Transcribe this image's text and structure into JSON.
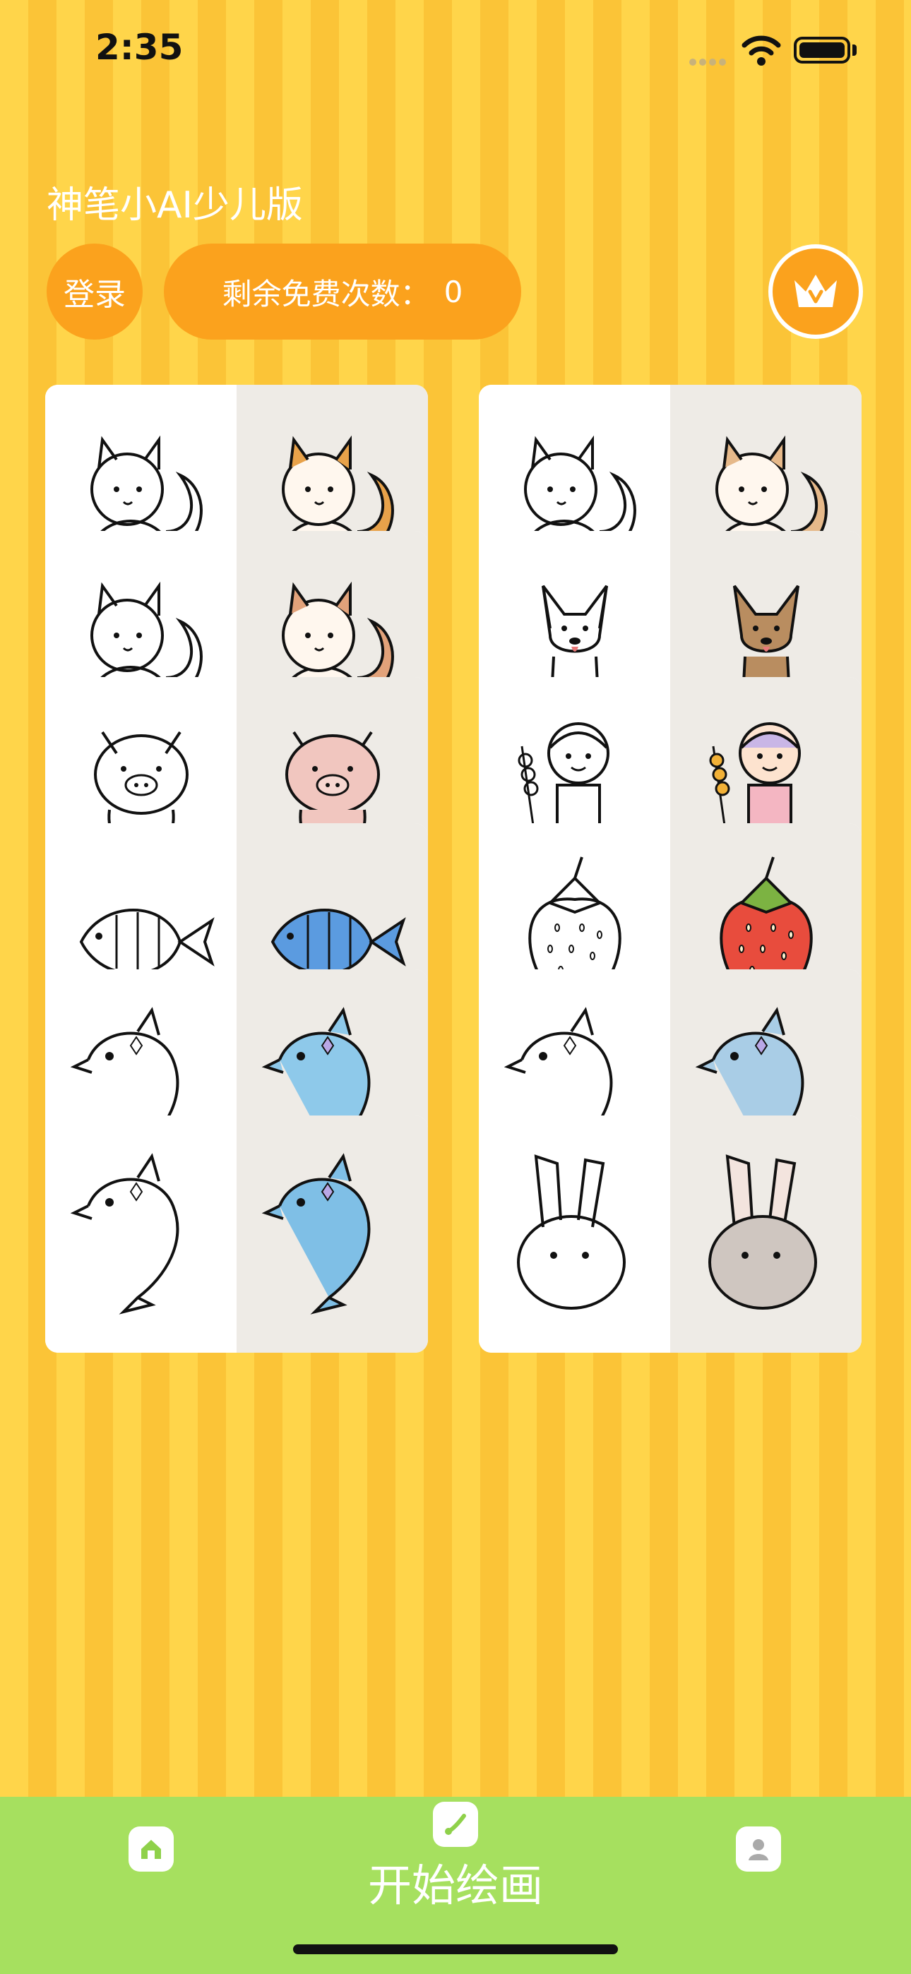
{
  "status": {
    "time": "2:35"
  },
  "header": {
    "title": "神笔小AI少儿版",
    "login_label": "登录",
    "free_label": "剩余免费次数：",
    "free_count": "0",
    "vip_icon": "crown-icon"
  },
  "gallery": {
    "cards": [
      {
        "name": "squirrel-1",
        "sketch": "squirrel",
        "color": "squirrel",
        "tint": "#e8a24a"
      },
      {
        "name": "squirrel-2",
        "sketch": "squirrel",
        "color": "squirrel",
        "tint": "#e6b98a"
      },
      {
        "name": "squirrel-3",
        "sketch": "squirrel",
        "color": "squirrel",
        "tint": "#e2a27a"
      },
      {
        "name": "dog",
        "sketch": "dog",
        "color": "dog",
        "tint": "#b98d60"
      },
      {
        "name": "pig",
        "sketch": "pig",
        "color": "pig",
        "tint": "#f1c6bf"
      },
      {
        "name": "boy",
        "sketch": "boy",
        "color": "boy",
        "tint": "#f4b6c2"
      },
      {
        "name": "fish",
        "sketch": "fish",
        "color": "fish",
        "tint": "#5b9be0"
      },
      {
        "name": "strawberry",
        "sketch": "strawberry",
        "color": "strawberry",
        "tint": "#e84c3d"
      },
      {
        "name": "dolphin-1",
        "sketch": "dolphin",
        "color": "dolphin",
        "tint": "#8ec9ea"
      },
      {
        "name": "dolphin-2",
        "sketch": "dolphin",
        "color": "dolphin",
        "tint": "#a9cde6"
      },
      {
        "name": "dolphin-3",
        "sketch": "dolphin",
        "color": "dolphin",
        "tint": "#7fbfe6"
      },
      {
        "name": "rabbit",
        "sketch": "rabbit",
        "color": "rabbit",
        "tint": "#cfc6c0"
      }
    ]
  },
  "tabbar": {
    "home_icon": "home-icon",
    "draw_icon": "brush-icon",
    "draw_label": "开始绘画",
    "profile_icon": "user-icon"
  },
  "colors": {
    "accent": "#fba21d",
    "tabbar": "#a6e05f",
    "stripe_light": "#ffd54a",
    "stripe_dark": "#fbc437"
  }
}
